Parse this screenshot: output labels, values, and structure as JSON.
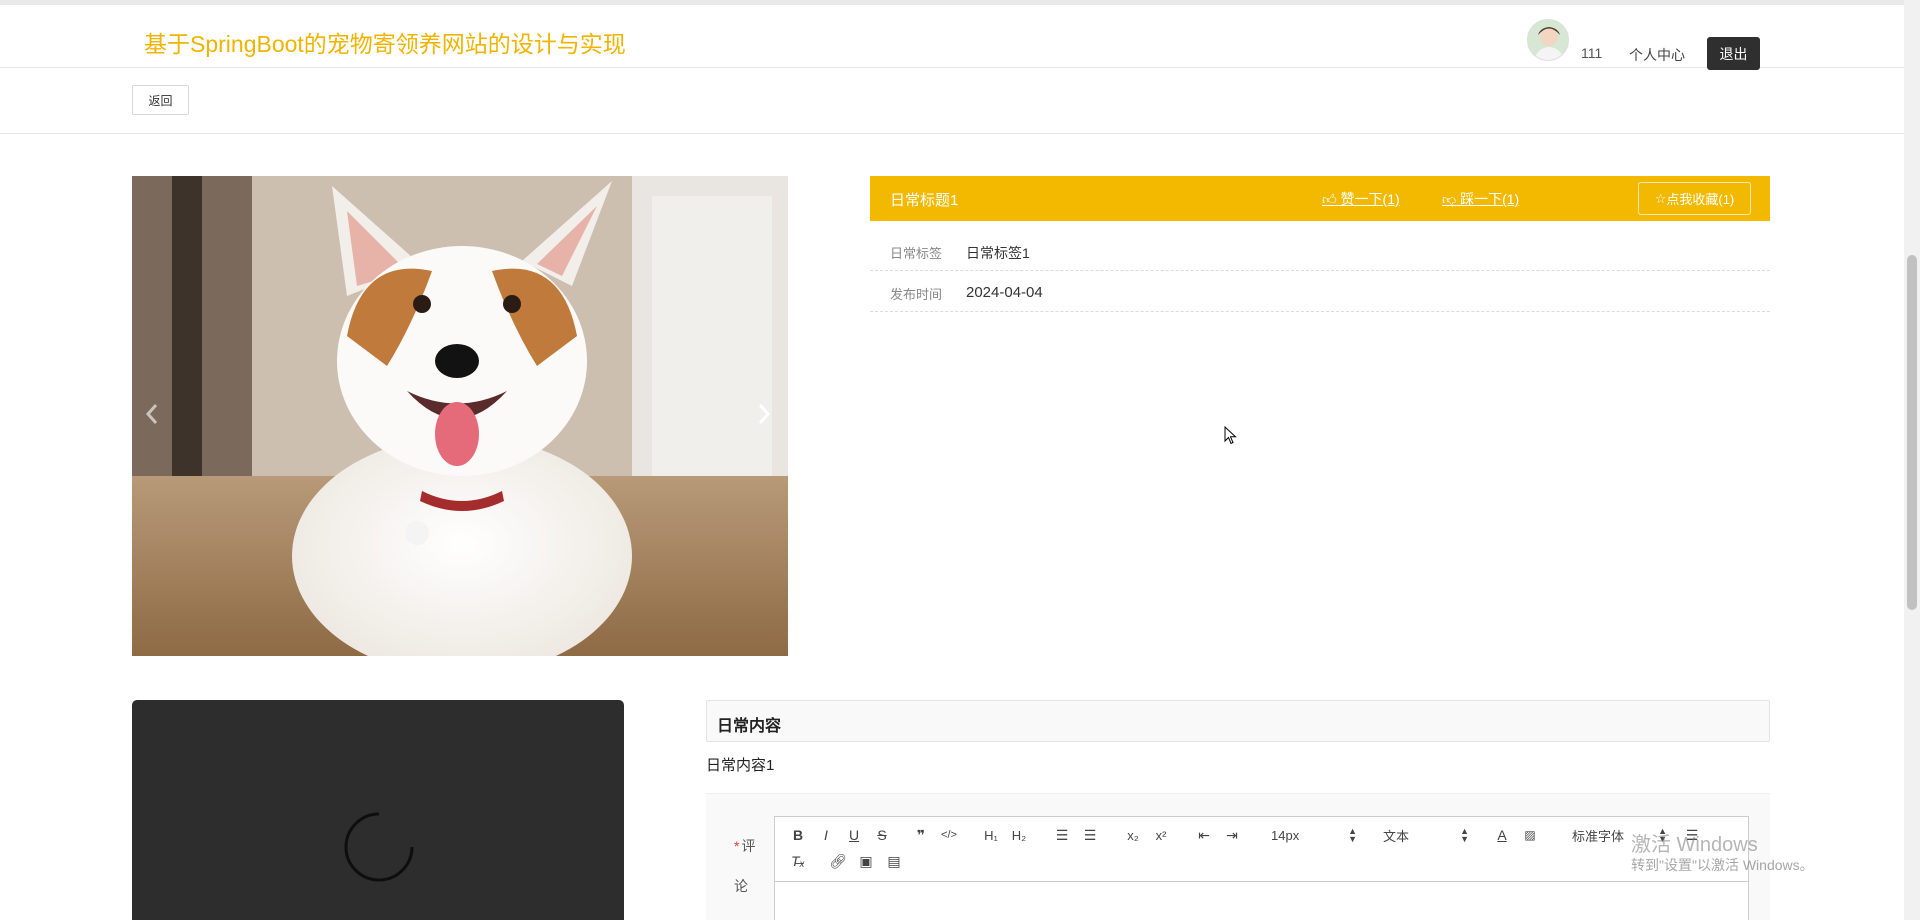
{
  "header": {
    "site_title": "基于SpringBoot的宠物寄领养网站的设计与实现",
    "username": "111",
    "profile_link": "个人中心",
    "logout": "退出",
    "back": "返回"
  },
  "detail": {
    "title": "日常标题1",
    "like": "赞一下(1)",
    "dislike": "踩一下(1)",
    "favorite": "点我收藏(1)",
    "fields": [
      {
        "label": "日常标签",
        "value": "日常标签1"
      },
      {
        "label": "发布时间",
        "value": "2024-04-04"
      }
    ]
  },
  "content": {
    "heading": "日常内容",
    "text": "日常内容1"
  },
  "comment": {
    "required_mark": "*",
    "label": "评论",
    "font_size": "14px",
    "paragraph": "文本",
    "font_family": "标准字体"
  },
  "watermark": {
    "line1": "激活 Windows",
    "line2": "转到\"设置\"以激活 Windows。"
  },
  "colors": {
    "brand": "#f0b400",
    "header_bar": "#f2b900",
    "logout_bg": "#2f2f2f",
    "video_bg": "#2d2d2d"
  }
}
